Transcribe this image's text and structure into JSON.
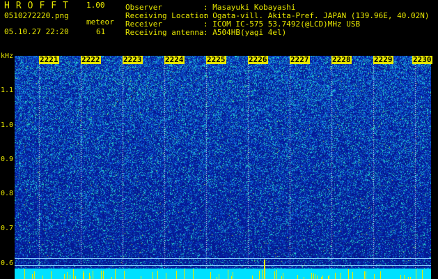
{
  "app": {
    "logo": "HROFFT",
    "version": "1.00",
    "filename": "0510272220.png",
    "timestamp": "05.10.27 22:20",
    "meteor_label": "meteor",
    "meteor_count": "61"
  },
  "info": [
    {
      "label": "Observer",
      "value": ": Masayuki Kobayashi"
    },
    {
      "label": "Receiving Location",
      "value": ": Ogata-vill. Akita-Pref. JAPAN (139.96E, 40.02N)"
    },
    {
      "label": "Receiver",
      "value": ": ICOM IC-575 53.7492(@LCD)MHz USB"
    },
    {
      "label": "Receiving antenna",
      "value": ": A504HB(yagi 4el)"
    }
  ],
  "axes": {
    "y_unit": "kHz",
    "x_ticks": [
      "2221",
      "2222",
      "2223",
      "2224",
      "2225",
      "2226",
      "2227",
      "2228",
      "2229",
      "2230"
    ],
    "y_ticks": [
      "1.1",
      "1.0",
      "0.9",
      "0.8",
      "0.7",
      "0.6"
    ]
  },
  "colors": {
    "text": "#e8e800",
    "background": "#000000",
    "strip": "#00e0ff"
  }
}
